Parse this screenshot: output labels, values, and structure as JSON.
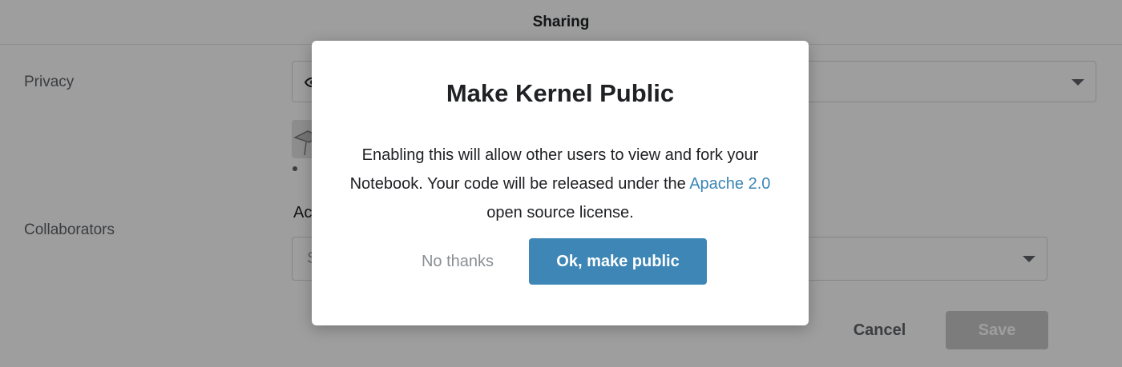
{
  "header": {
    "title": "Sharing"
  },
  "form": {
    "privacy_label": "Privacy",
    "collaborators_label": "Collaborators",
    "add_label": "Ac",
    "collab_search_placeholder": "S",
    "cancel_label": "Cancel",
    "save_label": "Save"
  },
  "modal": {
    "title": "Make Kernel Public",
    "body_part1": "Enabling this will allow other users to view and fork your Notebook. Your code will be released under the ",
    "body_link": "Apache 2.0",
    "body_part2": " open source license.",
    "no_thanks_label": "No thanks",
    "ok_label": "Ok, make public"
  },
  "colors": {
    "accent": "#3d86b6",
    "link": "#3a85b5",
    "save_disabled": "#c9c9c9"
  },
  "icons": [
    "eye-icon",
    "chevron-down-icon",
    "avatar"
  ]
}
